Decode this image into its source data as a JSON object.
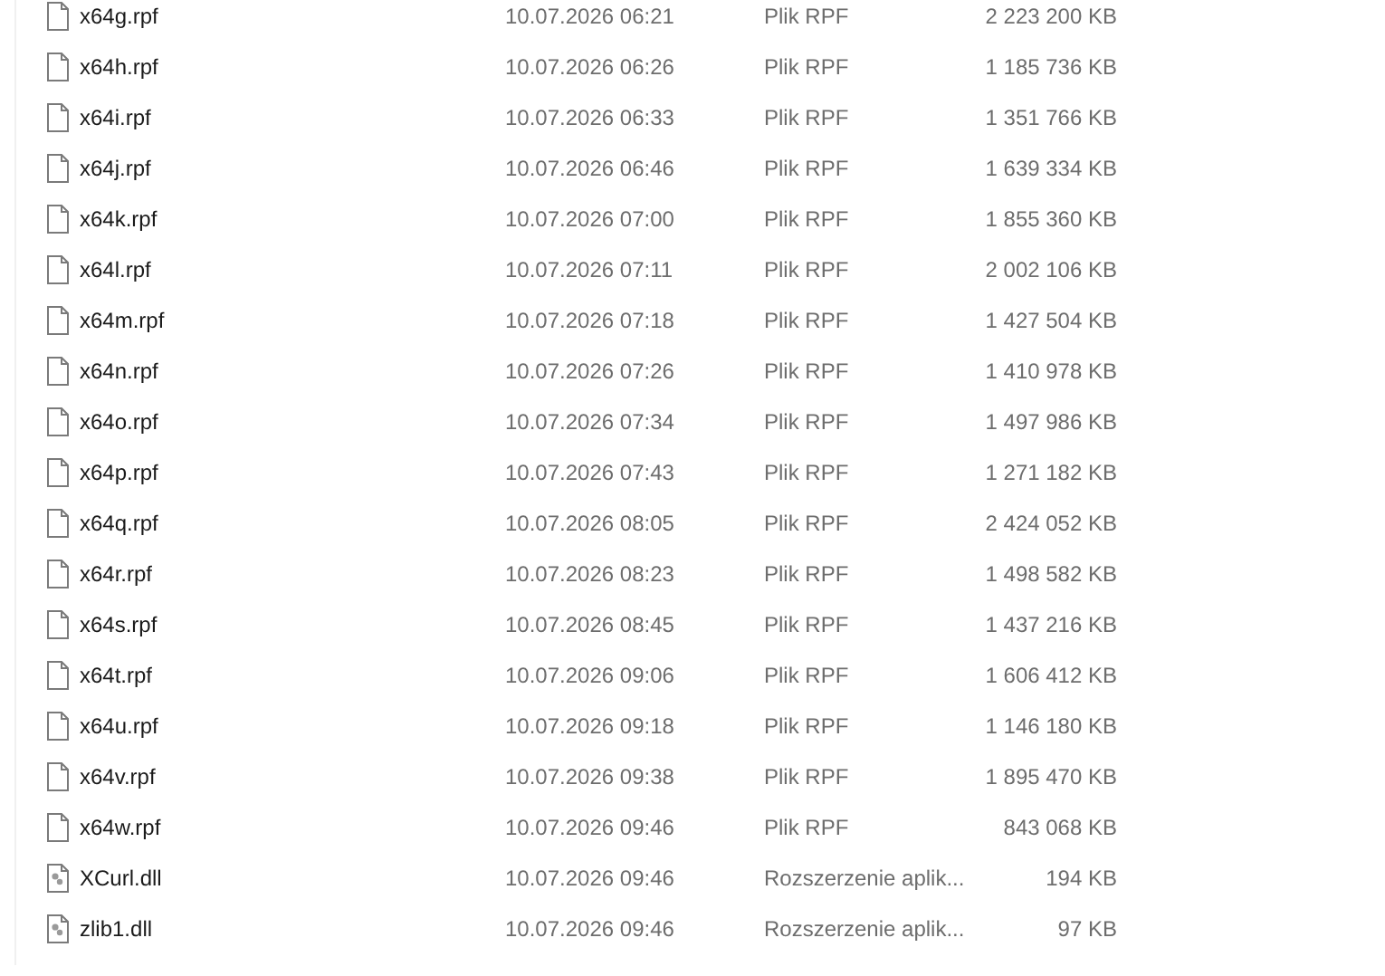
{
  "files": [
    {
      "kind": "file",
      "name": "x64g.rpf",
      "date": "10.07.2026 06:21",
      "type": "Plik RPF",
      "size": "2 223 200 KB"
    },
    {
      "kind": "file",
      "name": "x64h.rpf",
      "date": "10.07.2026 06:26",
      "type": "Plik RPF",
      "size": "1 185 736 KB"
    },
    {
      "kind": "file",
      "name": "x64i.rpf",
      "date": "10.07.2026 06:33",
      "type": "Plik RPF",
      "size": "1 351 766 KB"
    },
    {
      "kind": "file",
      "name": "x64j.rpf",
      "date": "10.07.2026 06:46",
      "type": "Plik RPF",
      "size": "1 639 334 KB"
    },
    {
      "kind": "file",
      "name": "x64k.rpf",
      "date": "10.07.2026 07:00",
      "type": "Plik RPF",
      "size": "1 855 360 KB"
    },
    {
      "kind": "file",
      "name": "x64l.rpf",
      "date": "10.07.2026 07:11",
      "type": "Plik RPF",
      "size": "2 002 106 KB"
    },
    {
      "kind": "file",
      "name": "x64m.rpf",
      "date": "10.07.2026 07:18",
      "type": "Plik RPF",
      "size": "1 427 504 KB"
    },
    {
      "kind": "file",
      "name": "x64n.rpf",
      "date": "10.07.2026 07:26",
      "type": "Plik RPF",
      "size": "1 410 978 KB"
    },
    {
      "kind": "file",
      "name": "x64o.rpf",
      "date": "10.07.2026 07:34",
      "type": "Plik RPF",
      "size": "1 497 986 KB"
    },
    {
      "kind": "file",
      "name": "x64p.rpf",
      "date": "10.07.2026 07:43",
      "type": "Plik RPF",
      "size": "1 271 182 KB"
    },
    {
      "kind": "file",
      "name": "x64q.rpf",
      "date": "10.07.2026 08:05",
      "type": "Plik RPF",
      "size": "2 424 052 KB"
    },
    {
      "kind": "file",
      "name": "x64r.rpf",
      "date": "10.07.2026 08:23",
      "type": "Plik RPF",
      "size": "1 498 582 KB"
    },
    {
      "kind": "file",
      "name": "x64s.rpf",
      "date": "10.07.2026 08:45",
      "type": "Plik RPF",
      "size": "1 437 216 KB"
    },
    {
      "kind": "file",
      "name": "x64t.rpf",
      "date": "10.07.2026 09:06",
      "type": "Plik RPF",
      "size": "1 606 412 KB"
    },
    {
      "kind": "file",
      "name": "x64u.rpf",
      "date": "10.07.2026 09:18",
      "type": "Plik RPF",
      "size": "1 146 180 KB"
    },
    {
      "kind": "file",
      "name": "x64v.rpf",
      "date": "10.07.2026 09:38",
      "type": "Plik RPF",
      "size": "1 895 470 KB"
    },
    {
      "kind": "file",
      "name": "x64w.rpf",
      "date": "10.07.2026 09:46",
      "type": "Plik RPF",
      "size": "843 068 KB"
    },
    {
      "kind": "dll",
      "name": "XCurl.dll",
      "date": "10.07.2026 09:46",
      "type": "Rozszerzenie aplik...",
      "size": "194 KB"
    },
    {
      "kind": "dll",
      "name": "zlib1.dll",
      "date": "10.07.2026 09:46",
      "type": "Rozszerzenie aplik...",
      "size": "97 KB"
    }
  ]
}
